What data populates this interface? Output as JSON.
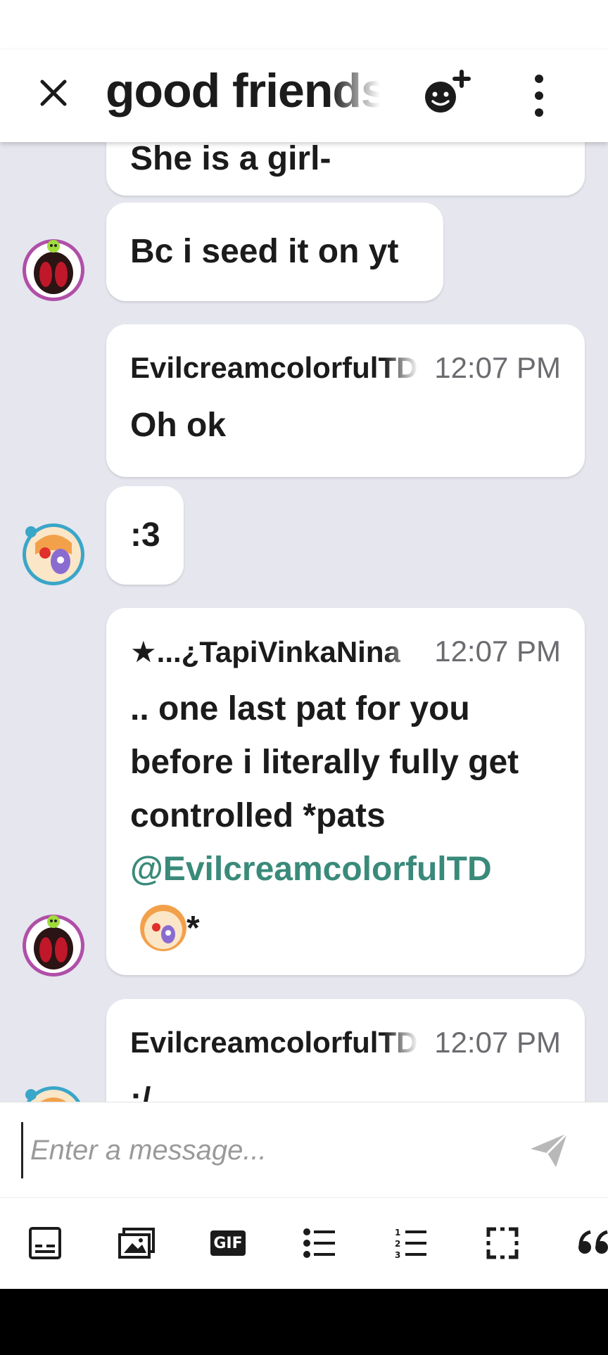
{
  "header": {
    "title": "good friends"
  },
  "messages": [
    {
      "text": "She is a girl-"
    },
    {
      "text": "Bc i seed it on yt"
    },
    {
      "sender": "EvilcreamcolorfulTD",
      "time": "12:07 PM",
      "text": "Oh ok"
    },
    {
      "text": ":3"
    },
    {
      "sender": "★...¿TapiVinkaNina",
      "time": "12:07 PM",
      "text": ".. one last pat for you before i literally fully get controlled *pats",
      "mention": "@EvilcreamcolorfulTD",
      "suffix": "*"
    },
    {
      "sender": "EvilcreamcolorfulTD",
      "time": "12:07 PM",
      "text": ":/"
    }
  ],
  "composer": {
    "placeholder": "Enter a message..."
  },
  "toolbar": {
    "items": [
      "sticker",
      "image",
      "gif",
      "bulleted-list",
      "numbered-list",
      "screenshot",
      "quote"
    ],
    "gif_label": "GIF"
  },
  "colors": {
    "background": "#e6e6ef",
    "bubble": "#ffffff",
    "mention": "#3a8a7a",
    "timestamp": "#6b6b70"
  }
}
